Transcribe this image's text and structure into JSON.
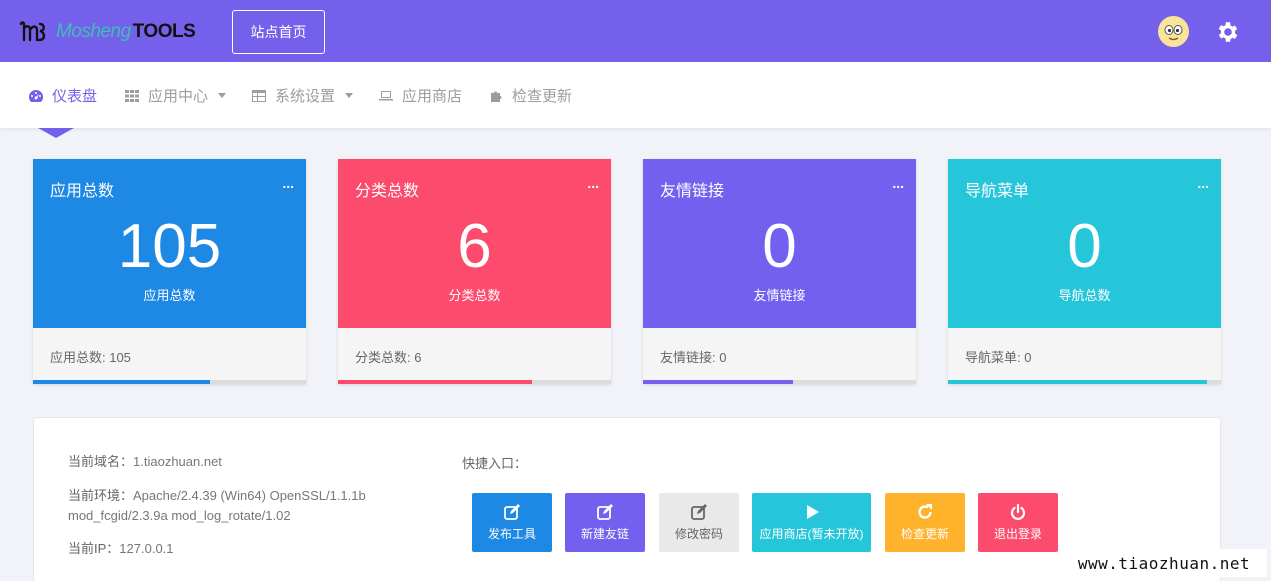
{
  "header": {
    "logo_text": "Mosheng",
    "logo_suffix": "TOOLS",
    "home_button": "站点首页",
    "colors": {
      "header_bg": "#7560ec"
    }
  },
  "nav": {
    "items": [
      {
        "label": "仪表盘",
        "icon": "dashboard-icon",
        "active": true
      },
      {
        "label": "应用中心",
        "icon": "grid-icon",
        "dropdown": true
      },
      {
        "label": "系统设置",
        "icon": "table-icon",
        "dropdown": true
      },
      {
        "label": "应用商店",
        "icon": "laptop-icon"
      },
      {
        "label": "检查更新",
        "icon": "puzzle-icon"
      }
    ]
  },
  "cards": [
    {
      "title": "应用总数",
      "more": "...",
      "value": "105",
      "sub": "应用总数",
      "footer": "应用总数:  105",
      "color": "#1e88e5",
      "progress": 0.65
    },
    {
      "title": "分类总数",
      "more": "...",
      "value": "6",
      "sub": "分类总数",
      "footer": "分类总数:  6",
      "color": "#fc4b6c",
      "progress": 0.71
    },
    {
      "title": "友情链接",
      "more": "...",
      "value": "0",
      "sub": "友情链接",
      "footer": "友情链接:  0",
      "color": "#7460ee",
      "progress": 0.55
    },
    {
      "title": "导航菜单",
      "more": "...",
      "value": "0",
      "sub": "导航总数",
      "footer": "导航菜单:  0",
      "color": "#26c6da",
      "progress": 0.95
    }
  ],
  "info": {
    "domain_label": "当前域名：",
    "domain_value": "1.tiaozhuan.net",
    "env_label": "当前环境：",
    "env_value_1": "Apache/2.4.39 (Win64) OpenSSL/1.1.1b",
    "env_value_2": "mod_fcgid/2.3.9a mod_log_rotate/1.02",
    "ip_label": "当前IP：",
    "ip_value": "127.0.0.1",
    "quick_label": "快捷入口："
  },
  "quick_buttons": [
    {
      "label": "发布工具",
      "icon": "edit-icon",
      "color": "#1e88e5"
    },
    {
      "label": "新建友链",
      "icon": "edit-icon",
      "color": "#7460ee"
    },
    {
      "label": "修改密码",
      "icon": "edit-icon",
      "color": "#e9e9e9"
    },
    {
      "label": "应用商店(暂未开放)",
      "icon": "play-icon",
      "color": "#26c6da"
    },
    {
      "label": "检查更新",
      "icon": "refresh-icon",
      "color": "#ffb22b"
    },
    {
      "label": "退出登录",
      "icon": "power-icon",
      "color": "#fc4b6c"
    }
  ],
  "watermark": "www.tiaozhuan.net"
}
